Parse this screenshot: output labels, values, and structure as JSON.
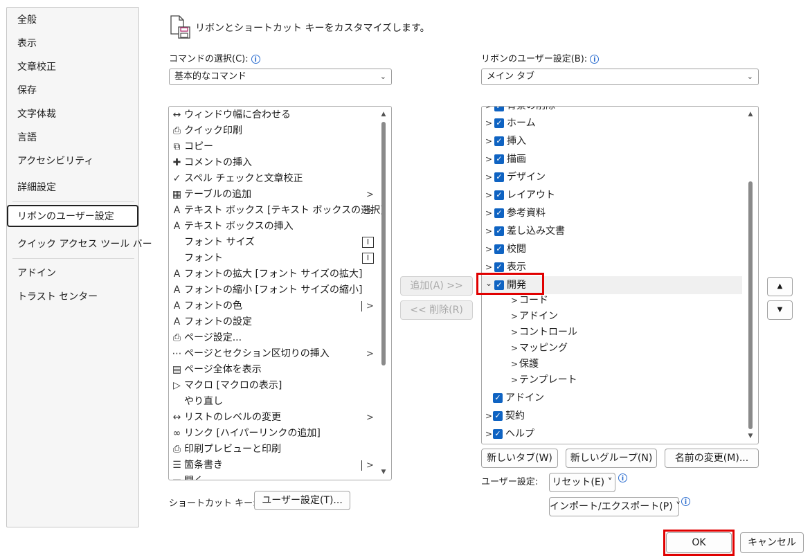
{
  "nav": {
    "items": [
      {
        "label": "全般"
      },
      {
        "label": "表示"
      },
      {
        "label": "文章校正"
      },
      {
        "label": "保存"
      },
      {
        "label": "文字体裁"
      },
      {
        "label": "言語"
      },
      {
        "label": "アクセシビリティ"
      },
      {
        "label": "詳細設定"
      },
      {
        "label": "リボンのユーザー設定"
      },
      {
        "label": "クイック アクセス ツール バー"
      },
      {
        "label": "アドイン"
      },
      {
        "label": "トラスト センター"
      }
    ],
    "selected": "リボンのユーザー設定"
  },
  "header": {
    "title": "リボンとショートカット キーをカスタマイズします。"
  },
  "commands": {
    "label": "コマンドの選択(C):",
    "dropdown_value": "基本的なコマンド",
    "items": [
      {
        "label": "ウィンドウ幅に合わせる",
        "icon": "fit-width-icon",
        "glyph": "↔"
      },
      {
        "label": "クイック印刷",
        "icon": "quick-print-icon",
        "glyph": "⎙"
      },
      {
        "label": "コピー",
        "icon": "copy-icon",
        "glyph": "⧉"
      },
      {
        "label": "コメントの挿入",
        "icon": "comment-icon",
        "glyph": "✚"
      },
      {
        "label": "スペル チェックと文章校正",
        "icon": "spellcheck-icon",
        "glyph": "✓"
      },
      {
        "label": "テーブルの追加",
        "icon": "table-icon",
        "glyph": "▦",
        "arrow": ">"
      },
      {
        "label": "テキスト ボックス [テキスト ボックスの選択]",
        "icon": "textbox-icon",
        "glyph": "A",
        "arrow": ">"
      },
      {
        "label": "テキスト ボックスの挿入",
        "icon": "textbox-insert-icon",
        "glyph": "A"
      },
      {
        "label": "フォント サイズ",
        "icon": "",
        "glyph": "",
        "box": "I"
      },
      {
        "label": "フォント",
        "icon": "",
        "glyph": "",
        "box": "I"
      },
      {
        "label": "フォントの拡大 [フォント サイズの拡大]",
        "icon": "font-grow-icon",
        "glyph": "A"
      },
      {
        "label": "フォントの縮小 [フォント サイズの縮小]",
        "icon": "font-shrink-icon",
        "glyph": "A"
      },
      {
        "label": "フォントの色",
        "icon": "font-color-icon",
        "glyph": "A",
        "split": ">"
      },
      {
        "label": "フォントの設定",
        "icon": "font-settings-icon",
        "glyph": "A"
      },
      {
        "label": "ページ設定...",
        "icon": "page-setup-icon",
        "glyph": "⎙"
      },
      {
        "label": "ページとセクション区切りの挿入",
        "icon": "page-break-icon",
        "glyph": "⋯",
        "arrow": ">"
      },
      {
        "label": "ページ全体を表示",
        "icon": "full-page-icon",
        "glyph": "▤"
      },
      {
        "label": "マクロ [マクロの表示]",
        "icon": "macro-icon",
        "glyph": "▷"
      },
      {
        "label": "やり直し",
        "icon": "",
        "glyph": ""
      },
      {
        "label": "リストのレベルの変更",
        "icon": "list-level-icon",
        "glyph": "↔",
        "arrow": ">"
      },
      {
        "label": "リンク [ハイパーリンクの追加]",
        "icon": "link-icon",
        "glyph": "∞"
      },
      {
        "label": "印刷プレビューと印刷",
        "icon": "print-preview-icon",
        "glyph": "⎙"
      },
      {
        "label": "箇条書き",
        "icon": "bullets-icon",
        "glyph": "☰",
        "split": ">"
      },
      {
        "label": "開く",
        "icon": "open-icon",
        "glyph": "▭"
      }
    ]
  },
  "shortcut": {
    "label": "ショートカット キー:",
    "button": "ユーザー設定(T)..."
  },
  "mid_buttons": {
    "add": "追加(A) >>",
    "remove": "<< 削除(R)"
  },
  "ribbon": {
    "label": "リボンのユーザー設定(B):",
    "dropdown_value": "メイン タブ",
    "partial_top": "背景の削除",
    "tabs": [
      {
        "label": "ホーム"
      },
      {
        "label": "挿入"
      },
      {
        "label": "描画"
      },
      {
        "label": "デザイン"
      },
      {
        "label": "レイアウト"
      },
      {
        "label": "参考資料"
      },
      {
        "label": "差し込み文書"
      },
      {
        "label": "校閲"
      },
      {
        "label": "表示"
      },
      {
        "label": "開発"
      }
    ],
    "groups": [
      {
        "label": "コード"
      },
      {
        "label": "アドイン"
      },
      {
        "label": "コントロール"
      },
      {
        "label": "マッピング"
      },
      {
        "label": "保護"
      },
      {
        "label": "テンプレート"
      }
    ],
    "after": [
      {
        "label": "アドイン"
      },
      {
        "label": "契約"
      },
      {
        "label": "ヘルプ"
      }
    ]
  },
  "ribbon_buttons": {
    "new_tab": "新しいタブ(W)",
    "new_group": "新しいグループ(N)",
    "rename": "名前の変更(M)..."
  },
  "user_settings": {
    "label": "ユーザー設定:",
    "reset": "リセット(E) ˅",
    "import_export": "インポート/エクスポート(P) ˅"
  },
  "footer": {
    "ok": "OK",
    "cancel": "キャンセル"
  },
  "colors": {
    "accent": "#0f63c2",
    "highlight": "#e00000"
  }
}
